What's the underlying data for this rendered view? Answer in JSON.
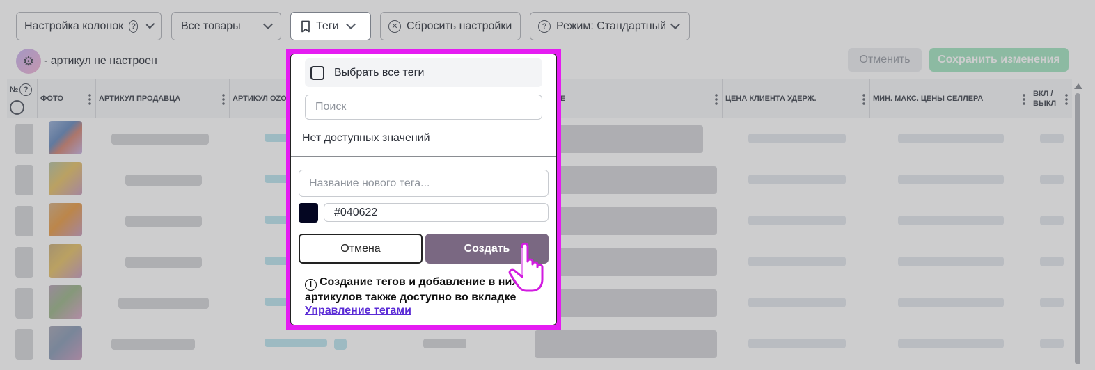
{
  "toolbar": {
    "columns_label": "Настройка колонок",
    "all_goods_label": "Все товары",
    "tags_label": "Теги",
    "reset_label": "Сбросить настройки",
    "mode_label": "Режим: Стандартный"
  },
  "sku_status": "- артикул не настроен",
  "actions": {
    "cancel_label": "Отменить",
    "save_label": "Сохранить изменения"
  },
  "table": {
    "columns": [
      "№",
      "ФОТО",
      "АРТИКУЛ ПРОДАВЦА",
      "АРТИКУЛ OZO",
      "НИЕ",
      "ЦЕНА КЛИЕНТА УДЕРЖ.",
      "МИН. МАКС. ЦЕНЫ СЕЛЛЕРА",
      "ВКЛ / ВЫКЛ"
    ]
  },
  "tags_popup": {
    "select_all_label": "Выбрать все теги",
    "search_placeholder": "Поиск",
    "empty_text": "Нет доступных значений",
    "new_tag_placeholder": "Название нового тега...",
    "color_value": "#040622",
    "cancel_label": "Отмена",
    "create_label": "Создать",
    "info_text": "Создание тегов и добавление в них артикулов также доступно во вкладке",
    "info_link": "Управление тегами"
  },
  "colors": {
    "highlight_frame": "#e51cf2",
    "create_button": "#7a6882",
    "save_button": "#a8e6c4",
    "swatch": "#040622"
  },
  "icons": [
    "help-icon",
    "chevron-down-icon",
    "bookmark-icon",
    "close-circle-icon",
    "gear-icon",
    "checkbox-icon",
    "info-icon",
    "hand-cursor-icon"
  ]
}
